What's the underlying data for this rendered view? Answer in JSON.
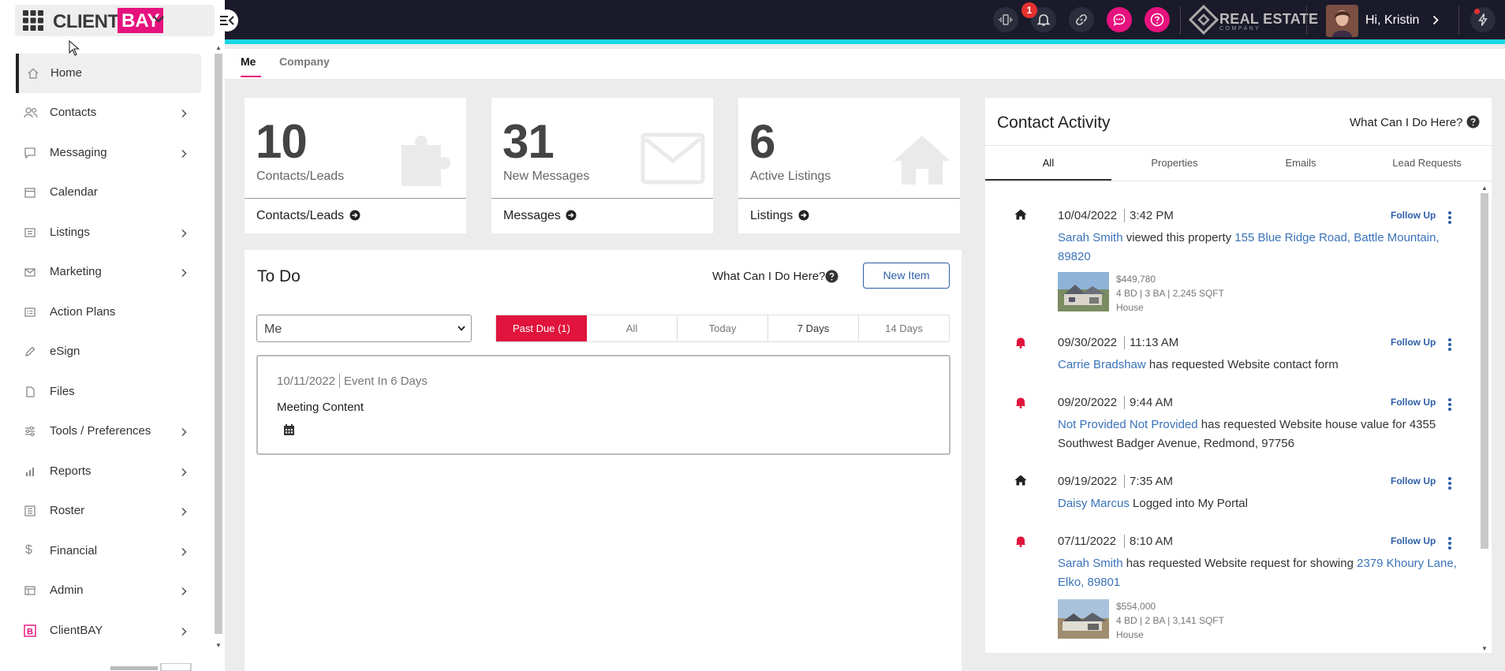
{
  "brand": {
    "name_part1": "CLIENT",
    "name_part2": "BAY"
  },
  "sidebar": {
    "items": [
      {
        "label": "Home",
        "icon": "home-icon"
      },
      {
        "label": "Contacts",
        "icon": "people-icon"
      },
      {
        "label": "Messaging",
        "icon": "chat-icon"
      },
      {
        "label": "Calendar",
        "icon": "calendar-icon"
      },
      {
        "label": "Listings",
        "icon": "list-icon"
      },
      {
        "label": "Marketing",
        "icon": "mail-icon"
      },
      {
        "label": "Action Plans",
        "icon": "plan-icon"
      },
      {
        "label": "eSign",
        "icon": "pen-icon"
      },
      {
        "label": "Files",
        "icon": "file-icon"
      },
      {
        "label": "Tools / Preferences",
        "icon": "sliders-icon"
      },
      {
        "label": "Reports",
        "icon": "bar-chart-icon"
      },
      {
        "label": "Roster",
        "icon": "roster-icon"
      },
      {
        "label": "Financial",
        "icon": "dollar-icon"
      },
      {
        "label": "Admin",
        "icon": "admin-icon"
      },
      {
        "label": "ClientBAY",
        "icon": "clientbay-icon"
      }
    ]
  },
  "topbar": {
    "notification_count": "1",
    "company_line1": "REAL ESTATE",
    "company_line2": "COMPANY",
    "greeting": "Hi, Kristin"
  },
  "tabs": {
    "me": "Me",
    "company": "Company"
  },
  "stats": [
    {
      "number": "10",
      "label": "Contacts/Leads",
      "link": "Contacts/Leads"
    },
    {
      "number": "31",
      "label": "New Messages",
      "link": "Messages"
    },
    {
      "number": "6",
      "label": "Active Listings",
      "link": "Listings"
    }
  ],
  "todo": {
    "title": "To Do",
    "help": "What Can I Do Here?",
    "new_item": "New Item",
    "assignee": "Me",
    "filters": [
      "Past Due (1)",
      "All",
      "Today",
      "7 Days",
      "14 Days"
    ],
    "event": {
      "date": "10/11/2022",
      "when": "Event In 6 Days",
      "title": "Meeting Content"
    }
  },
  "activity": {
    "title": "Contact Activity",
    "help": "What Can I Do Here?",
    "tabs": [
      "All",
      "Properties",
      "Emails",
      "Lead Requests"
    ],
    "follow_up": "Follow Up",
    "events": [
      {
        "date": "10/04/2022",
        "time": "3:42 PM",
        "who": "Sarah Smith",
        "text": " viewed this property ",
        "link": "155 Blue Ridge Road, Battle Mountain, 89820",
        "price": "$449,780",
        "specs": "4 BD | 3 BA | 2,245 SQFT",
        "type": "House"
      },
      {
        "date": "09/30/2022",
        "time": "11:13 AM",
        "who": "Carrie Bradshaw",
        "text": " has requested Website contact form"
      },
      {
        "date": "09/20/2022",
        "time": "9:44 AM",
        "who": "Not Provided Not Provided",
        "text": " has requested Website house value for 4355 Southwest Badger Avenue, Redmond, 97756"
      },
      {
        "date": "09/19/2022",
        "time": "7:35 AM",
        "who": "Daisy Marcus",
        "text": " Logged into My Portal"
      },
      {
        "date": "07/11/2022",
        "time": "8:10 AM",
        "who": "Sarah Smith",
        "text": " has requested Website request for showing ",
        "link": "2379 Khoury Lane, Elko, 89801",
        "price": "$554,000",
        "specs": "4 BD | 2 BA | 3,141 SQFT",
        "type": "House"
      }
    ]
  },
  "colors": {
    "brand_pink": "#e6127d",
    "accent_cyan": "#1ad6e5",
    "topbar": "#1a1a2a",
    "alert_red": "#e0143c",
    "link_blue": "#3a73b8"
  }
}
